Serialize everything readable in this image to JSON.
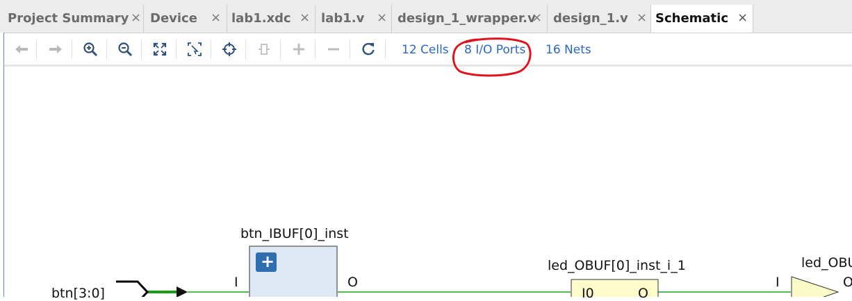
{
  "tabs": [
    {
      "label": "Project Summary",
      "close": "×"
    },
    {
      "label": "Device",
      "close": "×"
    },
    {
      "label": "lab1.xdc",
      "close": "×"
    },
    {
      "label": "lab1.v",
      "close": "×"
    },
    {
      "label": "design_1_wrapper.v",
      "close": "×"
    },
    {
      "label": "design_1.v",
      "close": "×"
    },
    {
      "label": "Schematic",
      "close": "×"
    }
  ],
  "toolbar": {
    "icons": [
      "back-arrow-icon",
      "forward-arrow-icon",
      "zoom-in-icon",
      "zoom-out-icon",
      "fit-view-icon",
      "zoom-area-icon",
      "crosshair-icon",
      "regenerate-icon",
      "expand-icon",
      "collapse-icon",
      "refresh-icon"
    ],
    "cells": "12 Cells",
    "ports": "8 I/O Ports",
    "nets": "16 Nets",
    "highlight_color": "#e0141e"
  },
  "schematic": {
    "port_label": "btn[3:0]",
    "ibuf_name": "btn_IBUF[0]_inst",
    "ibuf_pin_in": "I",
    "ibuf_pin_out": "O",
    "expand_glyph": "+",
    "lut_name": "led_OBUF[0]_inst_i_1",
    "lut_pin_in": "I0",
    "lut_pin_out": "O",
    "obuf_name": "led_OBU",
    "obuf_pin_in": "I",
    "obuf_pin_out": "O",
    "colors": {
      "wire_green": "#19a019",
      "ibuf_fill": "#dfe9f6",
      "lut_fill": "#fffccc",
      "obuf_fill": "#fbfbc8",
      "expand_btn": "#2f6fb0"
    }
  }
}
